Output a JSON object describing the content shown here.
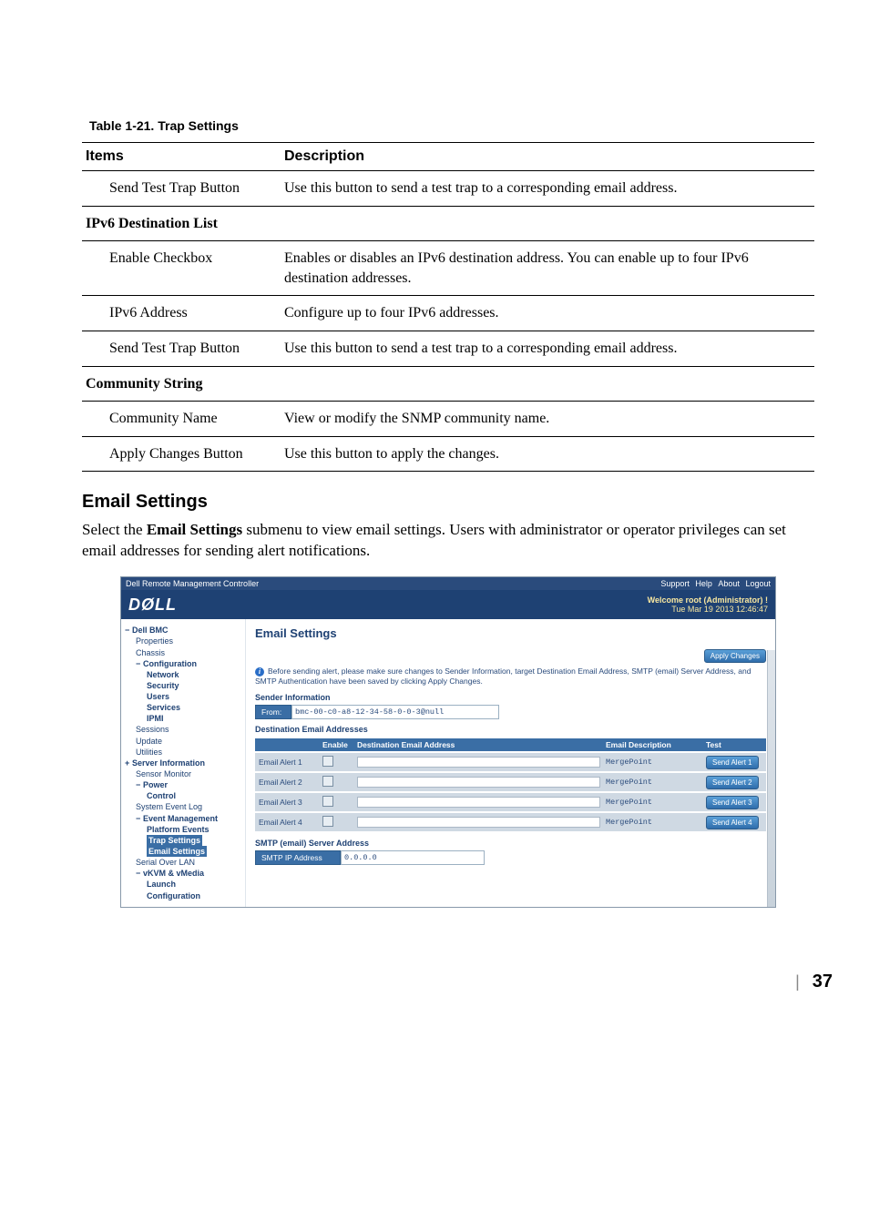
{
  "caption": "Table 1-21.    Trap Settings",
  "table": {
    "headers": [
      "Items",
      "Description"
    ],
    "rows": [
      {
        "item": "Send Test Trap Button",
        "desc": "Use this button to send a test trap to a corresponding email address.",
        "indent": true
      },
      {
        "item": "IPv6 Destination List",
        "desc": "",
        "section": true
      },
      {
        "item": "Enable Checkbox",
        "desc": "Enables or disables an IPv6 destination address. You can enable up to four IPv6 destination addresses.",
        "indent": true
      },
      {
        "item": "IPv6 Address",
        "desc": "Configure up to four IPv6 addresses.",
        "indent": true
      },
      {
        "item": "Send Test Trap Button",
        "desc": "Use this button to send a test trap to a corresponding email address.",
        "indent": true
      },
      {
        "item": "Community String",
        "desc": "",
        "section": true
      },
      {
        "item": "Community Name",
        "desc": "View or modify the SNMP community name.",
        "indent": true
      },
      {
        "item": "Apply Changes Button",
        "desc": "Use this button to apply the changes.",
        "indent": true,
        "last": true
      }
    ]
  },
  "heading": "Email Settings",
  "paragraph_pre": "Select the ",
  "paragraph_bold": "Email Settings",
  "paragraph_post": " submenu to view email settings. Users with administrator or operator privileges can set email addresses for sending alert notifications.",
  "shot": {
    "titlebar_left": "Dell Remote Management Controller",
    "titlebar_links": [
      "Support",
      "Help",
      "About",
      "Logout"
    ],
    "brand": "DØLL",
    "welcome": "Welcome root (Administrator) !",
    "timestamp": "Tue Mar 19 2013 12:46:47",
    "sidebar": {
      "dell_bmc": "Dell BMC",
      "properties": "Properties",
      "chassis": "Chassis",
      "configuration": "Configuration",
      "network": "Network",
      "security": "Security",
      "users": "Users",
      "services": "Services",
      "ipmi": "IPMI",
      "sessions": "Sessions",
      "update": "Update",
      "utilities": "Utilities",
      "server_info": "Server Information",
      "sensor_monitor": "Sensor Monitor",
      "power": "Power",
      "control": "Control",
      "system_event_log": "System Event Log",
      "event_mgmt": "Event Management",
      "platform_events": "Platform Events",
      "trap_settings": "Trap Settings",
      "email_settings": "Email Settings",
      "serial_over_lan": "Serial Over LAN",
      "vkvm": "vKVM & vMedia",
      "launch": "Launch",
      "configuration2": "Configuration"
    },
    "main": {
      "title": "Email Settings",
      "apply": "Apply Changes",
      "note": "Before sending alert, please make sure changes to Sender Information, target Destination Email Address, SMTP (email) Server Address, and SMTP Authentication have been saved by clicking Apply Changes.",
      "sender_info": "Sender Information",
      "from_label": "From:",
      "from_value": "bmc-00-c0-a8-12-34-58-0-0-3@null",
      "dest_label": "Destination Email Addresses",
      "columns": {
        "c0": "",
        "c1": "Enable",
        "c2": "Destination Email Address",
        "c3": "Email Description",
        "c4": "Test"
      },
      "rows": [
        {
          "name": "Email Alert 1",
          "desc": "MergePoint",
          "btn": "Send Alert 1"
        },
        {
          "name": "Email Alert 2",
          "desc": "MergePoint",
          "btn": "Send Alert 2"
        },
        {
          "name": "Email Alert 3",
          "desc": "MergePoint",
          "btn": "Send Alert 3"
        },
        {
          "name": "Email Alert 4",
          "desc": "MergePoint",
          "btn": "Send Alert 4"
        }
      ],
      "smtp_label": "SMTP (email) Server Address",
      "smtp_ip_label": "SMTP IP Address",
      "smtp_ip_value": "0.0.0.0"
    }
  },
  "page_number": "37"
}
